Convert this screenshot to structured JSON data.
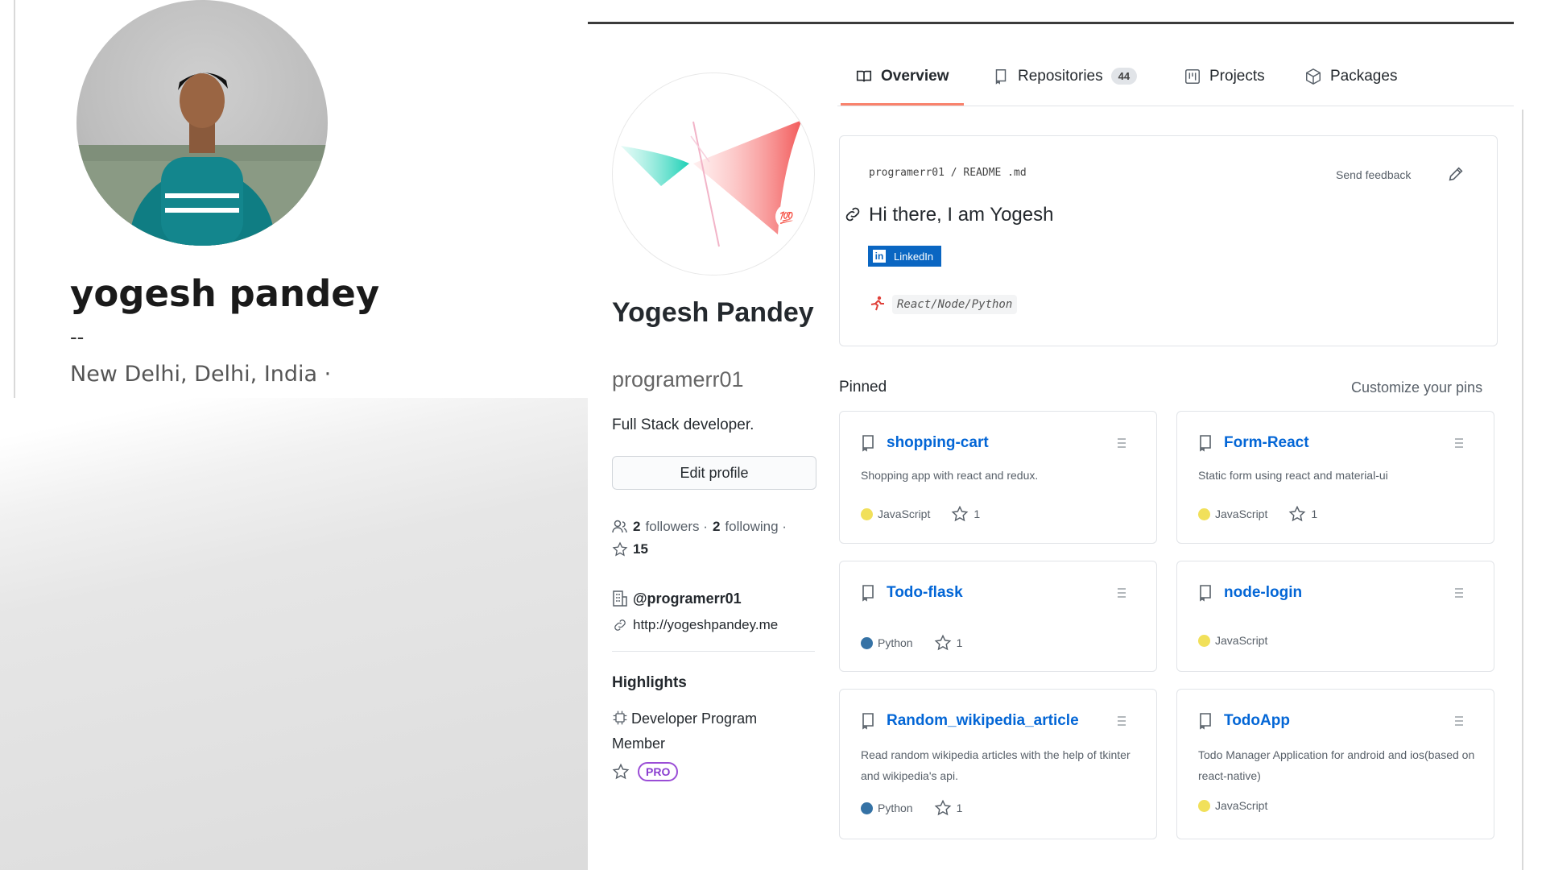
{
  "linkedin_card": {
    "name": "yogesh pandey",
    "headline": "--",
    "location": "New Delhi, Delhi, India ·"
  },
  "tabs": [
    {
      "label": "Overview",
      "icon": "book-icon",
      "active": true
    },
    {
      "label": "Repositories",
      "icon": "repo-icon",
      "count": "44"
    },
    {
      "label": "Projects",
      "icon": "project-icon"
    },
    {
      "label": "Packages",
      "icon": "package-icon"
    }
  ],
  "sidebar": {
    "name": "Yogesh Pandey",
    "username": "programerr01",
    "bio": "Full Stack developer.",
    "edit_label": "Edit profile",
    "followers_count": "2",
    "followers_label": "followers ·",
    "following_count": "2",
    "following_label": "following ·",
    "stars": "15",
    "org": "@programerr01",
    "website": "http://yogeshpandey.me",
    "highlights_title": "Highlights",
    "highlight_dev": "Developer Program Member",
    "pro_label": "PRO"
  },
  "readme": {
    "path": "programerr01 / README .md",
    "feedback": "Send feedback",
    "heading": "Hi there, I am Yogesh",
    "linkedin_label": "LinkedIn",
    "stack": "React/Node/Python"
  },
  "pinned": {
    "title": "Pinned",
    "customize": "Customize your pins",
    "repos": [
      {
        "name": "shopping-cart",
        "desc": "Shopping app with react and redux.",
        "lang": "JavaScript",
        "lang_color": "#f1e05a",
        "stars": "1"
      },
      {
        "name": "Form-React",
        "desc": "Static form using react and material-ui",
        "lang": "JavaScript",
        "lang_color": "#f1e05a",
        "stars": "1"
      },
      {
        "name": "Todo-flask",
        "desc": "",
        "lang": "Python",
        "lang_color": "#3572A5",
        "stars": "1"
      },
      {
        "name": "node-login",
        "desc": "",
        "lang": "JavaScript",
        "lang_color": "#f1e05a",
        "stars": ""
      },
      {
        "name": "Random_wikipedia_article",
        "desc": "Read random wikipedia articles with the help of tkinter and wikipedia's api.",
        "lang": "Python",
        "lang_color": "#3572A5",
        "stars": "1"
      },
      {
        "name": "TodoApp",
        "desc": "Todo Manager Application for android and ios(based on react-native)",
        "lang": "JavaScript",
        "lang_color": "#f1e05a",
        "stars": ""
      }
    ]
  },
  "colors": {
    "link_blue": "#0366d6",
    "tab_underline": "#f9826c",
    "linkedin_blue": "#0a66c2",
    "pro_purple": "#8a3dd0"
  }
}
